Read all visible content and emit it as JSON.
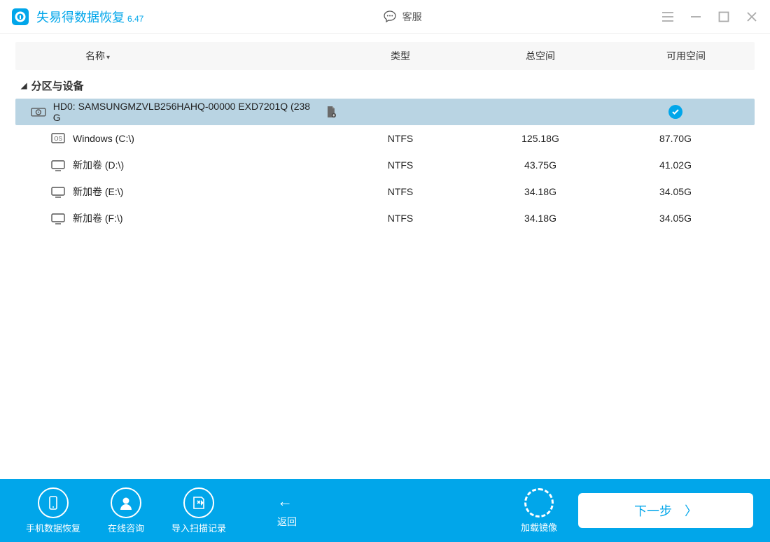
{
  "app": {
    "title": "失易得数据恢复",
    "version": "6.47",
    "support_label": "客服"
  },
  "columns": {
    "name": "名称",
    "type": "类型",
    "total": "总空间",
    "free": "可用空间"
  },
  "section": {
    "title": "分区与设备"
  },
  "disk": {
    "name": "HD0:  SAMSUNGMZVLB256HAHQ-00000 EXD7201Q (238 G",
    "type": "",
    "total": "",
    "free": ""
  },
  "rows": [
    {
      "name": "Windows (C:\\)",
      "type": "NTFS",
      "total": "125.18G",
      "free": "87.70G",
      "icon": "os"
    },
    {
      "name": "新加卷 (D:\\)",
      "type": "NTFS",
      "total": "43.75G",
      "free": "41.02G",
      "icon": "drive"
    },
    {
      "name": "新加卷 (E:\\)",
      "type": "NTFS",
      "total": "34.18G",
      "free": "34.05G",
      "icon": "drive"
    },
    {
      "name": "新加卷 (F:\\)",
      "type": "NTFS",
      "total": "34.18G",
      "free": "34.05G",
      "icon": "drive"
    }
  ],
  "bottom": {
    "phone_recovery": "手机数据恢复",
    "consult": "在线咨询",
    "import_scan": "导入扫描记录",
    "back": "返回",
    "load_image": "加载镜像",
    "next": "下一步"
  }
}
